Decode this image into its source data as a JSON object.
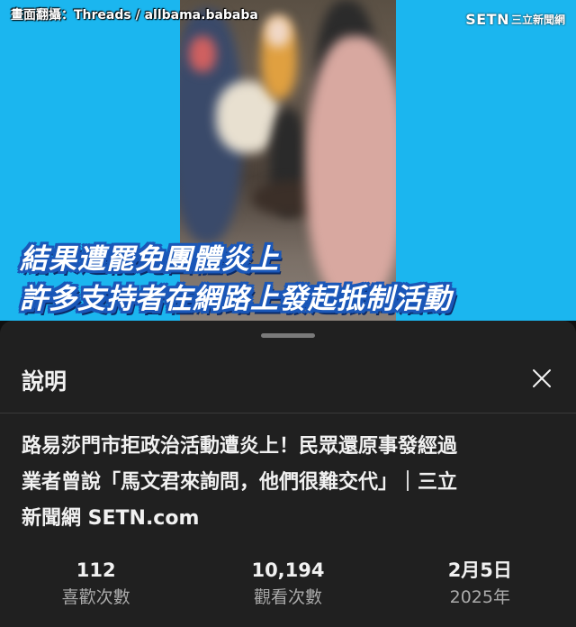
{
  "video": {
    "watermark": "畫面翻攝：Threads / allbama.bababa",
    "brand_main": "SETN",
    "brand_sub": "三立新聞網",
    "caption_line1": "結果遭罷免團體炎上",
    "caption_line2": "許多支持者在網路上發起抵制活動"
  },
  "sheet": {
    "title": "說明",
    "close_icon": "close-icon",
    "description_line1": "路易莎門市拒政治活動遭炎上！民眾還原事發經過",
    "description_line2": "業者曾說「馬文君來詢問，他們很難交代」｜三立",
    "description_line3": "新聞網 SETN.com",
    "stats": [
      {
        "value": "112",
        "label": "喜歡次數"
      },
      {
        "value": "10,194",
        "label": "觀看次數"
      },
      {
        "value": "2月5日",
        "label": "2025年"
      }
    ]
  },
  "colors": {
    "video_background": "#1bb6ef",
    "sheet_background": "#202020",
    "caption_outline": "#1a57b8",
    "muted_text": "#aaaaaa"
  }
}
